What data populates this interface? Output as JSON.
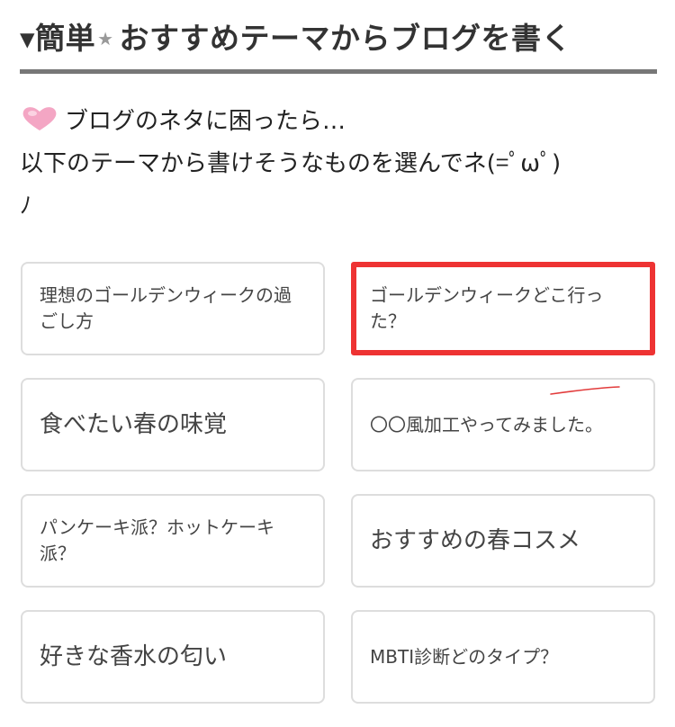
{
  "header": {
    "title_prefix": "▾簡単",
    "title_star": "★",
    "title_main": "おすすめテーマからブログを書く"
  },
  "intro": {
    "line1": "ブログのネタに困ったら…",
    "line2": "以下のテーマから書けそうなものを選んでネ(=ﾟωﾟ)",
    "line3": "ﾉ"
  },
  "themes": [
    {
      "label": "理想のゴールデンウィークの過ごし方"
    },
    {
      "label": "ゴールデンウィークどこ行った？"
    },
    {
      "label": "食べたい春の味覚"
    },
    {
      "label": "〇〇風加工やってみました。"
    },
    {
      "label": "パンケーキ派？ホットケーキ派？"
    },
    {
      "label": "おすすめの春コスメ"
    },
    {
      "label": "好きな香水の匂い"
    },
    {
      "label": "MBTI診断どのタイプ？"
    }
  ],
  "colors": {
    "highlight_border": "#ee3333",
    "heart": "#f4a6c4",
    "card_border": "#dddddd"
  }
}
